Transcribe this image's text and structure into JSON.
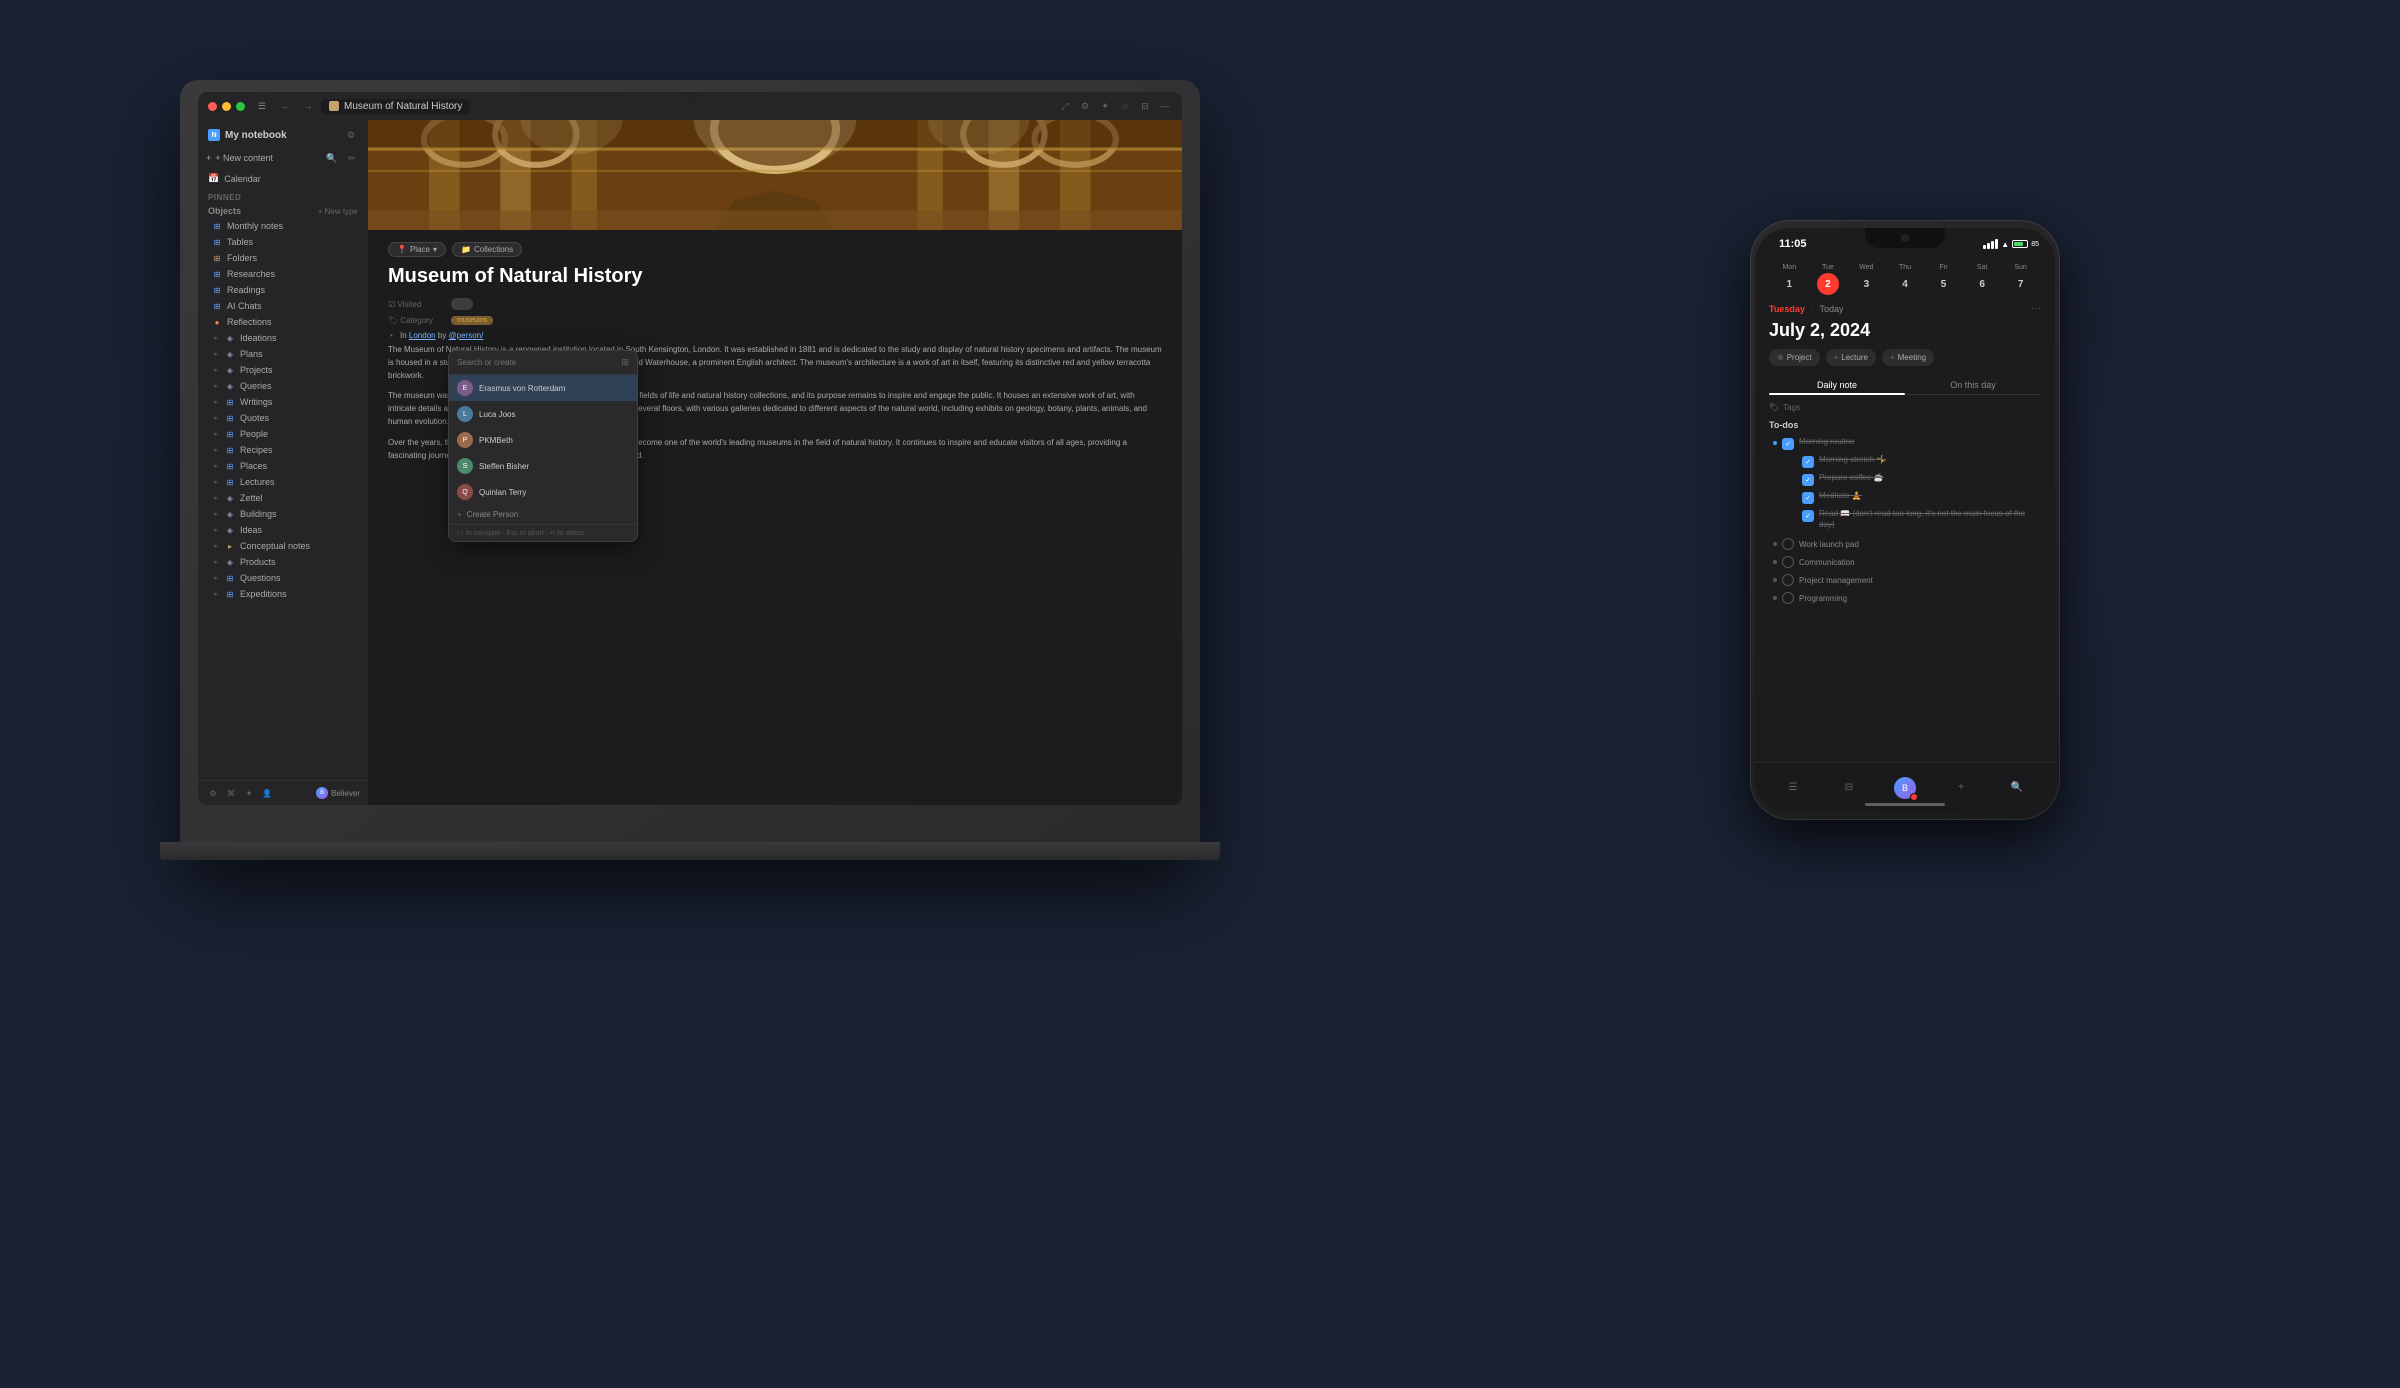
{
  "app": {
    "title": "Museum of Natural History",
    "workspace": "My notebook",
    "titlebar": {
      "tab_label": "Museum of Natural History"
    }
  },
  "sidebar": {
    "workspace_label": "My notebook",
    "new_content": "+ New content",
    "calendar": "Calendar",
    "pinned": "Pinned",
    "objects_label": "Objects",
    "new_type": "+ New type",
    "items": [
      {
        "label": "Monthly notes",
        "icon": "grid"
      },
      {
        "label": "Tables",
        "icon": "grid"
      },
      {
        "label": "Folders",
        "icon": "folder"
      },
      {
        "label": "Researches",
        "icon": "grid"
      },
      {
        "label": "Readings",
        "icon": "grid"
      },
      {
        "label": "AI Chats",
        "icon": "grid"
      },
      {
        "label": "Reflections",
        "icon": "orange-dot"
      },
      {
        "label": "Ideations",
        "icon": "diamond"
      },
      {
        "label": "Plans",
        "icon": "diamond"
      },
      {
        "label": "Projects",
        "icon": "diamond"
      },
      {
        "label": "Queries",
        "icon": "diamond"
      },
      {
        "label": "Writings",
        "icon": "grid"
      },
      {
        "label": "Quotes",
        "icon": "grid"
      },
      {
        "label": "People",
        "icon": "grid"
      },
      {
        "label": "Recipes",
        "icon": "grid"
      },
      {
        "label": "Places",
        "icon": "grid"
      },
      {
        "label": "Lectures",
        "icon": "grid"
      },
      {
        "label": "Zettel",
        "icon": "diamond"
      },
      {
        "label": "Buildings",
        "icon": "diamond"
      },
      {
        "label": "Ideas",
        "icon": "diamond"
      },
      {
        "label": "Conceptual notes",
        "icon": "folder"
      },
      {
        "label": "Products",
        "icon": "diamond"
      },
      {
        "label": "Questions",
        "icon": "grid"
      },
      {
        "label": "Expeditions",
        "icon": "grid"
      }
    ],
    "footer_user": "Believer"
  },
  "page": {
    "title": "Museum of Natural History",
    "breadcrumb_place": "Place",
    "breadcrumb_collections": "Collections",
    "visited_label": "Visited",
    "category_label": "Category",
    "category_value": "museums",
    "body_text_1": "The Museum of Natural History is a renowned institution located in South Kensington, London. It was established in 1881 and is dedicated to the study and display of natural history specimens and artifacts. The museum is housed in a stunning Gothic Romanesque building designed by Alfred Waterhouse, a prominent English architect. The museum's architecture is a work of art in itself, featuring its distinctive red and yellow terracotta brickwork.",
    "body_text_2": "The museum was founded with the aim of advancing knowledge in the fields of life and natural history collections, and its purpose remains to inspire and engage the public. It houses an extensive work of art, with intricate details and stunning displays. The museum is spread across several floors, with various galleries dedicated to different aspects of the natural world, including exhibits on geology, botany, plants, animals, and human evolution.",
    "body_text_3": "Over the years, the Museum of Natural History, London has grown to become one of the world's leading museums in the field of natural history. It continues to inspire and educate visitors of all ages, providing a fascinating journey through the history and wonders of the natural world.",
    "bullet_text": "In London by @person/",
    "bullet_link_london": "London",
    "bullet_link_person": "@person/"
  },
  "search_popup": {
    "placeholder": "Search or create",
    "items": [
      {
        "name": "Erasmus von Rotterdam",
        "avatar_color": "#7a5c8a"
      },
      {
        "name": "Luca Joos",
        "avatar_color": "#4a7a9b"
      },
      {
        "name": "PKMBeth",
        "avatar_color": "#9b6a4a"
      },
      {
        "name": "Steffen Bisher",
        "avatar_color": "#4a8a6a"
      },
      {
        "name": "Quinlan Terry",
        "avatar_color": "#8a4a4a"
      }
    ],
    "create_person": "Create Person",
    "footer_hint": "↑↓ to navigate · Esc to abort · ↵ to select"
  },
  "phone": {
    "time": "11:05",
    "date_label": "Tuesday · Today",
    "date_big": "July 2, 2024",
    "week_days": [
      {
        "name": "Mon",
        "num": "1"
      },
      {
        "name": "Tue",
        "num": "2",
        "today": true
      },
      {
        "name": "Wed",
        "num": "3"
      },
      {
        "name": "Thu",
        "num": "4"
      },
      {
        "name": "Fri",
        "num": "5"
      },
      {
        "name": "Sat",
        "num": "6"
      },
      {
        "name": "Sun",
        "num": "7"
      }
    ],
    "add_buttons": [
      {
        "label": "Project",
        "icon": "⊕"
      },
      {
        "label": "Lecture",
        "icon": "+"
      },
      {
        "label": "Meeting",
        "icon": "+"
      }
    ],
    "tabs": [
      {
        "label": "Daily note",
        "active": true
      },
      {
        "label": "On this day"
      }
    ],
    "tags_label": "Tags",
    "todos_label": "To-dos",
    "todos": [
      {
        "text": "Morning routine",
        "checked": true,
        "sub": [
          {
            "text": "Morning stretch 🤸",
            "checked": true,
            "done": true
          },
          {
            "text": "Prepare coffee ☕",
            "checked": true,
            "done": true
          },
          {
            "text": "Meditate 🧘",
            "checked": true,
            "done": true
          },
          {
            "text": "Read 📖 (don't read too long, it's not the main focus of the day)",
            "checked": true,
            "done": true
          }
        ]
      }
    ],
    "other_items": [
      {
        "text": "Work launch pad"
      },
      {
        "text": "Communication"
      },
      {
        "text": "Project management"
      },
      {
        "text": "Programming"
      }
    ],
    "nav": [
      {
        "icon": "☰",
        "label": "menu"
      },
      {
        "icon": "⊞",
        "label": "grid"
      },
      {
        "icon": "avatar",
        "label": "profile"
      },
      {
        "icon": "+",
        "label": "add"
      },
      {
        "icon": "⌕",
        "label": "search"
      }
    ]
  }
}
